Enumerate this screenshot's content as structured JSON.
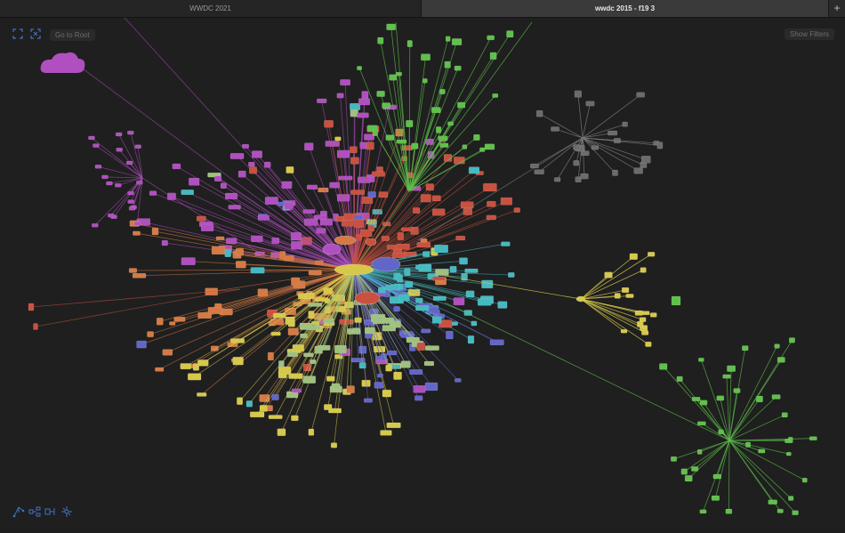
{
  "tabs": [
    {
      "label": "WWDC 2021",
      "active": false
    },
    {
      "label": "wwdc 2015 - f19 3",
      "active": true
    }
  ],
  "add_tab": "+",
  "toolbar": {
    "go_to_root": "Go to Root",
    "show_filters": "Show Filters"
  },
  "icons": {
    "expand": "expand-icon",
    "fit": "fit-to-screen-icon",
    "bottom": [
      "tree-layout-icon",
      "hierarchy-layout-icon",
      "horizontal-layout-icon",
      "radial-layout-icon"
    ]
  },
  "colors": {
    "background": "#1f1f1f",
    "purple": "#b04fc0",
    "red": "#c9513f",
    "orange": "#d57a44",
    "green": "#5fc04a",
    "yellow": "#d6c84a",
    "blue": "#6266c8",
    "cyan": "#45b9c0",
    "gray": "#7a7a7a",
    "beige": "#9fc07f"
  }
}
